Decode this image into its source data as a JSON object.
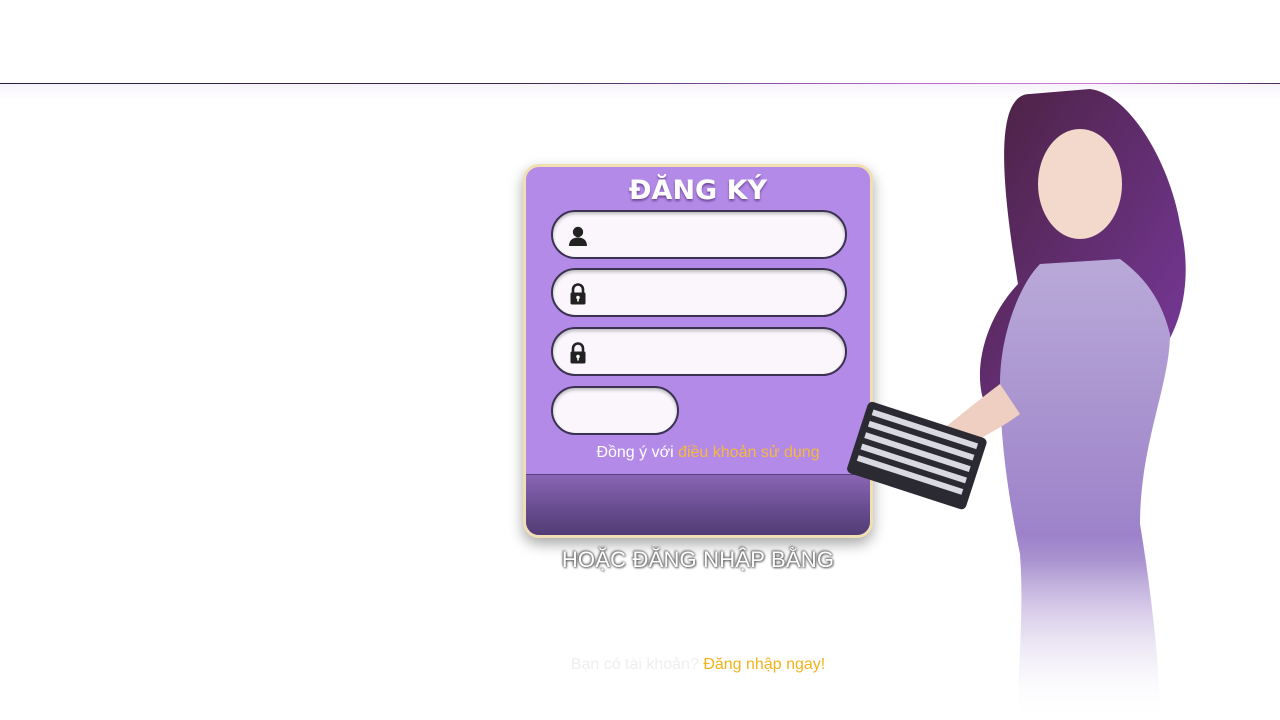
{
  "register": {
    "title": "ĐĂNG KÝ",
    "username": {
      "value": "",
      "placeholder": "",
      "icon": "user-icon"
    },
    "password": {
      "value": "",
      "placeholder": "",
      "icon": "lock-icon"
    },
    "confirm_password": {
      "value": "",
      "placeholder": "",
      "icon": "lock-icon"
    },
    "captcha": {
      "value": "",
      "placeholder": ""
    },
    "terms_prefix": "Đồng ý với",
    "terms_link": "điều khoản sử dụng",
    "submit_label": ""
  },
  "alt_login": {
    "label": "HOẶC ĐĂNG NHẬP BẰNG"
  },
  "footer": {
    "question": "Bạn có tài khoản?",
    "login_link": "Đăng nhập ngay!"
  },
  "colors": {
    "panel": "#b38ae8",
    "panel_border": "#f1dfb4",
    "submit_bar": "#6a4e92",
    "link": "#f5b93e",
    "footer_link": "#f2b21a"
  }
}
